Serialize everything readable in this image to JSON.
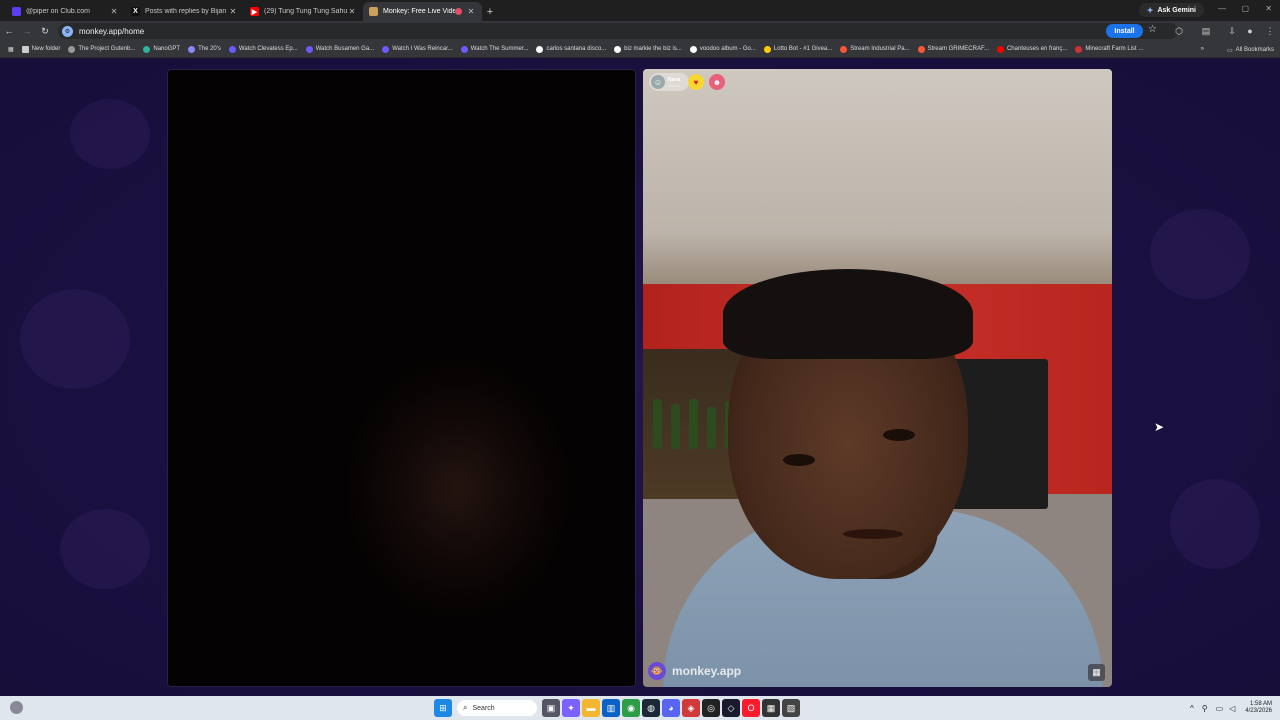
{
  "tabs": [
    {
      "title": "@piper on Club.com",
      "icon": "club-icon",
      "icon_color": "#5b3df5",
      "active": false
    },
    {
      "title": "Posts with replies by Bijan Tehr...",
      "icon": "x-icon",
      "icon_color": "#111111",
      "active": false
    },
    {
      "title": "(29) Tung Tung Tung Sahur - B...",
      "icon": "youtube-icon",
      "icon_color": "#ff0000",
      "active": false
    },
    {
      "title": "Monkey: Free Live Video Ch...",
      "icon": "monkey-icon",
      "icon_color": "#c9a15a",
      "active": true
    }
  ],
  "gemini_label": "Ask Gemini",
  "url": "monkey.app/home",
  "install_label": "Install",
  "bookmarks": [
    {
      "label": "New folder",
      "icon": "folder-icon",
      "color": "#cccccc"
    },
    {
      "label": "The Project Gutenb...",
      "icon": "gutenberg-icon",
      "color": "#999999"
    },
    {
      "label": "NanoGPT",
      "icon": "nanogpt-icon",
      "color": "#2bb3a0"
    },
    {
      "label": "The 20's",
      "icon": "globe-icon",
      "color": "#8888ff"
    },
    {
      "label": "Watch Clevatess Ep...",
      "icon": "m-icon",
      "color": "#6c5cff"
    },
    {
      "label": "Watch Busamen Ga...",
      "icon": "m-icon",
      "color": "#6c5cff"
    },
    {
      "label": "Watch I Was Reincar...",
      "icon": "m-icon",
      "color": "#6c5cff"
    },
    {
      "label": "Watch The Summer...",
      "icon": "m-icon",
      "color": "#6c5cff"
    },
    {
      "label": "carlos santana disco...",
      "icon": "google-icon",
      "color": "#ffffff"
    },
    {
      "label": "biz markie the biz is...",
      "icon": "google-icon",
      "color": "#ffffff"
    },
    {
      "label": "voodoo album - Go...",
      "icon": "google-icon",
      "color": "#ffffff"
    },
    {
      "label": "Lotto Bot - #1 Givea...",
      "icon": "lotto-icon",
      "color": "#ffcc00"
    },
    {
      "label": "Stream Industrial Pa...",
      "icon": "stream-icon",
      "color": "#ff5533"
    },
    {
      "label": "Stream GRIMECRAF...",
      "icon": "stream-icon",
      "color": "#ff5533"
    },
    {
      "label": "Chanteuses en franç...",
      "icon": "youtube-icon",
      "color": "#ff0000"
    },
    {
      "label": "Minecraft Farm List ...",
      "icon": "minecraft-icon",
      "color": "#cc3333"
    }
  ],
  "all_bookmarks_label": "All Bookmarks",
  "peer": {
    "name": "Nana",
    "country": "Ghana"
  },
  "watermark_text": "monkey.app",
  "taskbar": {
    "search_label": "Search",
    "time": "1:58 AM",
    "date": "4/23/2026"
  }
}
